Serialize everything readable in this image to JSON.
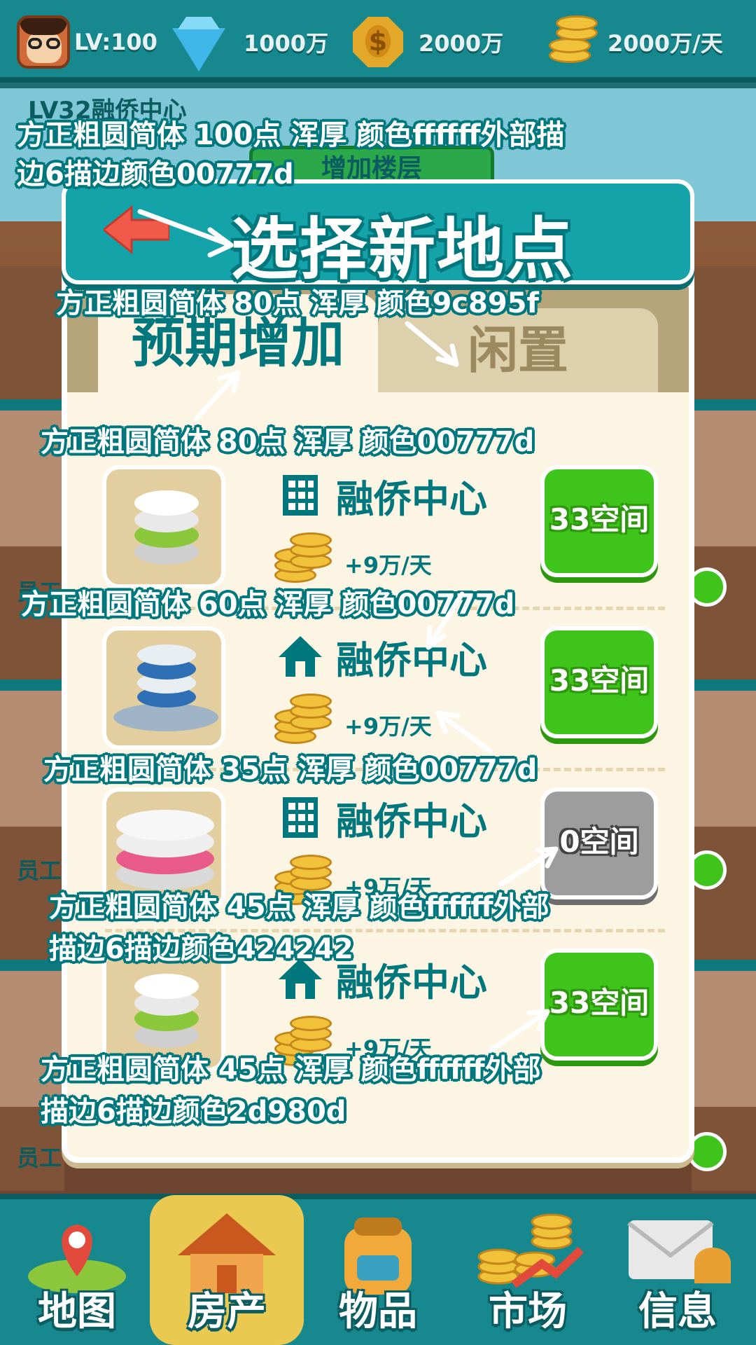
{
  "top_bar": {
    "level": "LV:100",
    "diamonds": "1000万",
    "coins": "2000万",
    "income": "2000万/天"
  },
  "background": {
    "building_title": "LV32融侨中心",
    "add_floor": "增加楼层",
    "staff_label": "员工"
  },
  "dialog": {
    "title": "选择新地点",
    "tabs": [
      {
        "label": "预期增加"
      },
      {
        "label": "闲置"
      }
    ],
    "rows": [
      {
        "name": "融侨中心",
        "rate": "+9万/天",
        "space": "33空间",
        "available": true,
        "icon": "office-building-icon"
      },
      {
        "name": "融侨中心",
        "rate": "+9万/天",
        "space": "33空间",
        "available": true,
        "icon": "house-icon"
      },
      {
        "name": "融侨中心",
        "rate": "+9万/天",
        "space": "0空间",
        "available": false,
        "icon": "office-building-icon"
      },
      {
        "name": "融侨中心",
        "rate": "+9万/天",
        "space": "33空间",
        "available": true,
        "icon": "house-icon"
      }
    ]
  },
  "annotations": {
    "title_note_line1": "方正粗圆简体 100点   浑厚   颜色ffffff外部描",
    "title_note_line2": "边6描边颜色00777d",
    "tab_inactive_note": "方正粗圆简体  80点    浑厚    颜色9c895f",
    "tab_active_note": "方正粗圆简体  80点    浑厚    颜色00777d",
    "name_note": "方正粗圆简体  60点    浑厚    颜色00777d",
    "rate_note": "方正粗圆简体 35点     浑厚     颜色00777d",
    "space_grey_note_line1": "方正粗圆简体 45点    浑厚    颜色ffffff外部",
    "space_grey_note_line2": "描边6描边颜色424242",
    "space_green_note_line1": "方正粗圆简体 45点    浑厚    颜色ffffff外部",
    "space_green_note_line2": "描边6描边颜色2d980d"
  },
  "bottom_nav": [
    {
      "label": "地图",
      "icon": "map-pin-icon"
    },
    {
      "label": "房产",
      "icon": "house-icon"
    },
    {
      "label": "物品",
      "icon": "backpack-icon"
    },
    {
      "label": "市场",
      "icon": "market-chart-icon"
    },
    {
      "label": "信息",
      "icon": "mail-icon"
    }
  ],
  "colors": {
    "teal": "#00777d",
    "tab_inactive": "#9c895f",
    "green_button": "#3ec41a",
    "green_stroke": "#2d980d",
    "grey_button": "#9d9d9d",
    "grey_stroke": "#424242"
  }
}
